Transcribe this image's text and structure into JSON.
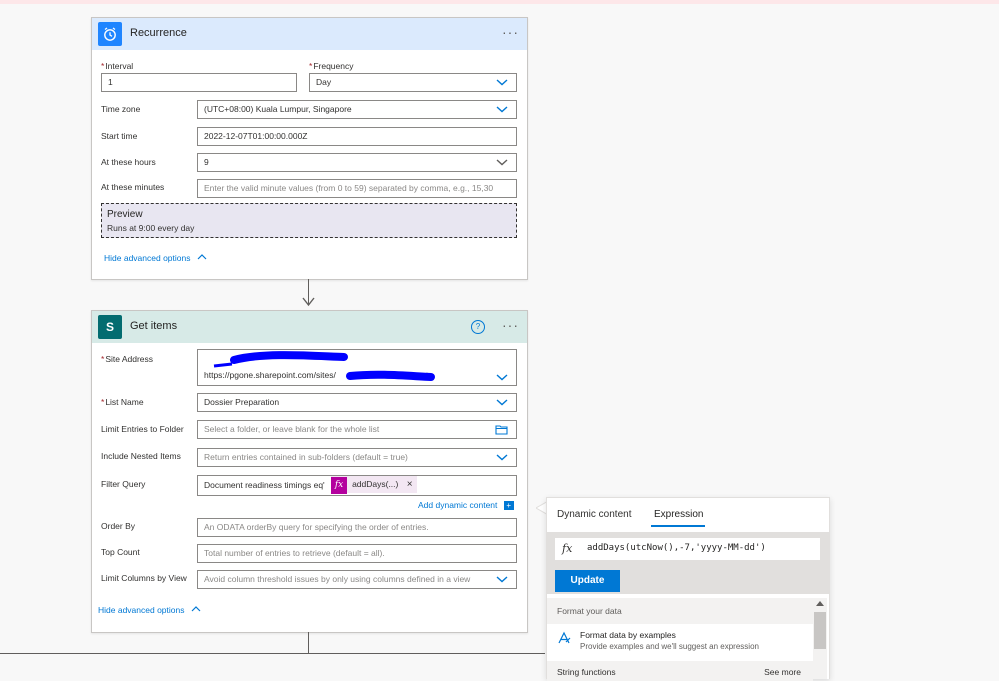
{
  "recurrence": {
    "title": "Recurrence",
    "more": "···",
    "interval_label": "Interval",
    "interval_value": "1",
    "frequency_label": "Frequency",
    "frequency_value": "Day",
    "timezone_label": "Time zone",
    "timezone_value": "(UTC+08:00) Kuala Lumpur, Singapore",
    "start_label": "Start time",
    "start_value": "2022-12-07T01:00:00.000Z",
    "hours_label": "At these hours",
    "hours_value": "9",
    "minutes_label": "At these minutes",
    "minutes_placeholder": "Enter the valid minute values (from 0 to 59) separated by comma, e.g., 15,30",
    "preview_title": "Preview",
    "preview_text": "Runs at 9:00 every day",
    "hide_advanced": "Hide advanced options"
  },
  "getitems": {
    "title": "Get items",
    "help": "?",
    "more": "···",
    "icon_letter": "S",
    "site_label": "Site Address",
    "site_value": "https://pgone.sharepoint.com/sites/",
    "site_value_end": "t",
    "list_label": "List Name",
    "list_value": "Dossier Preparation",
    "limit_label": "Limit Entries to Folder",
    "limit_placeholder": "Select a folder, or leave blank for the whole list",
    "nested_label": "Include Nested Items",
    "nested_placeholder": "Return entries contained in sub-folders (default = true)",
    "filter_label": "Filter Query",
    "filter_value": "Document readiness timings eq'",
    "filter_token": "addDays(...)",
    "filter_token_close": "×",
    "add_dynamic": "Add dynamic content",
    "orderby_label": "Order By",
    "orderby_placeholder": "An ODATA orderBy query for specifying the order of entries.",
    "topcount_label": "Top Count",
    "topcount_placeholder": "Total number of entries to retrieve (default = all).",
    "limitcols_label": "Limit Columns by View",
    "limitcols_placeholder": "Avoid column threshold issues by only using columns defined in a view",
    "hide_advanced": "Hide advanced options"
  },
  "panel": {
    "tab_dynamic": "Dynamic content",
    "tab_expression": "Expression",
    "expression": "addDays(utcNow(),-7,'yyyy-MM-dd')",
    "update": "Update",
    "section_format": "Format your data",
    "format_title": "Format data by examples",
    "format_desc": "Provide examples and we'll suggest an expression",
    "section_string": "String functions",
    "see_more": "See more"
  },
  "colors": {
    "recurrence_header": "#dbeafd",
    "recurrence_icon": "#1f85ff",
    "getitems_header": "#d7eae7",
    "sharepoint_icon": "#036c70",
    "accent": "#0078d4",
    "token": "#b4009e"
  }
}
